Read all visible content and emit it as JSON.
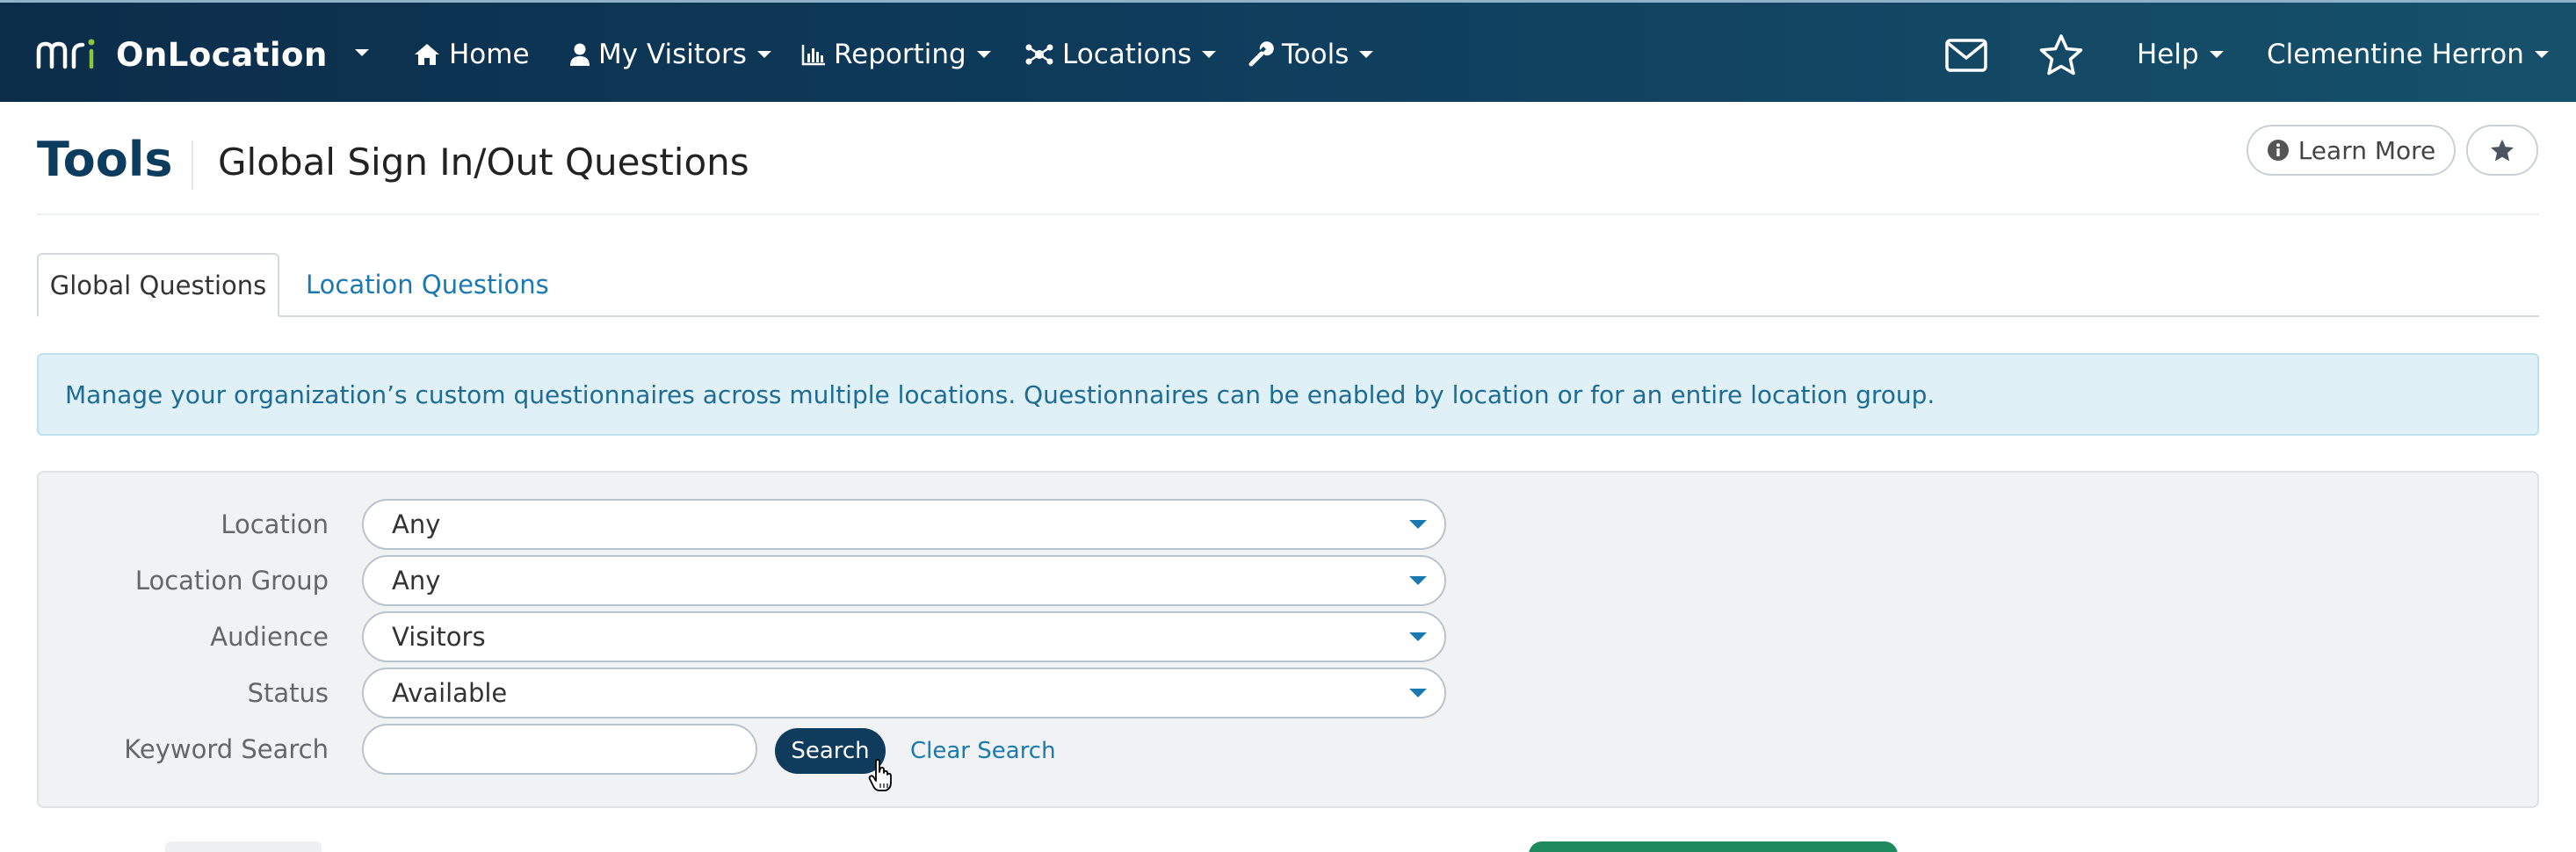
{
  "nav": {
    "brand": "OnLocation",
    "items": [
      {
        "label": "Home",
        "icon": "home-icon"
      },
      {
        "label": "My Visitors",
        "icon": "user-icon"
      },
      {
        "label": "Reporting",
        "icon": "bar-chart-icon"
      },
      {
        "label": "Locations",
        "icon": "network-icon"
      },
      {
        "label": "Tools",
        "icon": "wrench-icon"
      }
    ],
    "help": "Help",
    "user": "Clementine Herron"
  },
  "header": {
    "section": "Tools",
    "title": "Global Sign In/Out Questions",
    "learn_more": "Learn More"
  },
  "tabs": [
    {
      "label": "Global Questions",
      "active": true
    },
    {
      "label": "Location Questions",
      "active": false
    }
  ],
  "alert": {
    "text": "Manage your organization’s custom questionnaires across multiple locations. Questionnaires can be enabled by location or for an entire location group."
  },
  "filters": {
    "location": {
      "label": "Location",
      "value": "Any"
    },
    "location_group": {
      "label": "Location Group",
      "value": "Any"
    },
    "audience": {
      "label": "Audience",
      "value": "Visitors"
    },
    "status": {
      "label": "Status",
      "value": "Available"
    },
    "keyword": {
      "label": "Keyword Search",
      "value": "",
      "placeholder": ""
    },
    "search_button": "Search",
    "clear_search": "Clear Search"
  },
  "colors": {
    "navbar": "#0f3c5c",
    "accent": "#1a7ab0",
    "alert_bg": "#dff0f7",
    "success": "#1f8a5e"
  }
}
